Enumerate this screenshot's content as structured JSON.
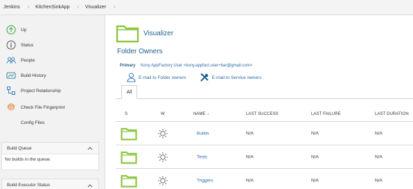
{
  "breadcrumb": [
    {
      "label": "Jenkins"
    },
    {
      "label": "KitchenSinkApp"
    },
    {
      "label": "Visualizer"
    }
  ],
  "sidebar": {
    "tasks": [
      {
        "label": "Up",
        "icon": "up-arrow-icon"
      },
      {
        "label": "Status",
        "icon": "info-icon"
      },
      {
        "label": "People",
        "icon": "people-icon"
      },
      {
        "label": "Build History",
        "icon": "build-history-icon"
      },
      {
        "label": "Project Relationship",
        "icon": "project-relationship-icon"
      },
      {
        "label": "Check File Fingerprint",
        "icon": "fingerprint-icon"
      },
      {
        "label": "Config Files",
        "icon": ""
      }
    ],
    "build_queue": {
      "title": "Build Queue",
      "empty_text": "No builds in the queue."
    },
    "executor_status": {
      "title": "Build Executor Status"
    }
  },
  "main": {
    "title": "Visualizer",
    "owners_title": "Folder Owners",
    "primary_label": "Primary",
    "primary_value": "Kony AppFactory User <kony.appfact.user+bar@gmail.com>",
    "email_folder_owners": "E-mail to Folder owners",
    "email_service_owners": "E-mail to Service owners",
    "tab_all": "All",
    "columns": {
      "s": "S",
      "w": "W",
      "name": "NAME ↓",
      "last_success": "LAST SUCCESS",
      "last_failure": "LAST FAILURE",
      "last_duration": "LAST DURATION"
    },
    "rows": [
      {
        "name": "Builds",
        "last_success": "N/A",
        "last_failure": "N/A",
        "last_duration": "N/A"
      },
      {
        "name": "Tests",
        "last_success": "N/A",
        "last_failure": "N/A",
        "last_duration": "N/A"
      },
      {
        "name": "Triggers",
        "last_success": "N/A",
        "last_failure": "N/A",
        "last_duration": "N/A"
      }
    ]
  },
  "colors": {
    "folder": "#8cc63f",
    "link": "#2a6aa6",
    "heading": "#1f5f8b",
    "sidebar_bg": "#f2f2f2"
  }
}
